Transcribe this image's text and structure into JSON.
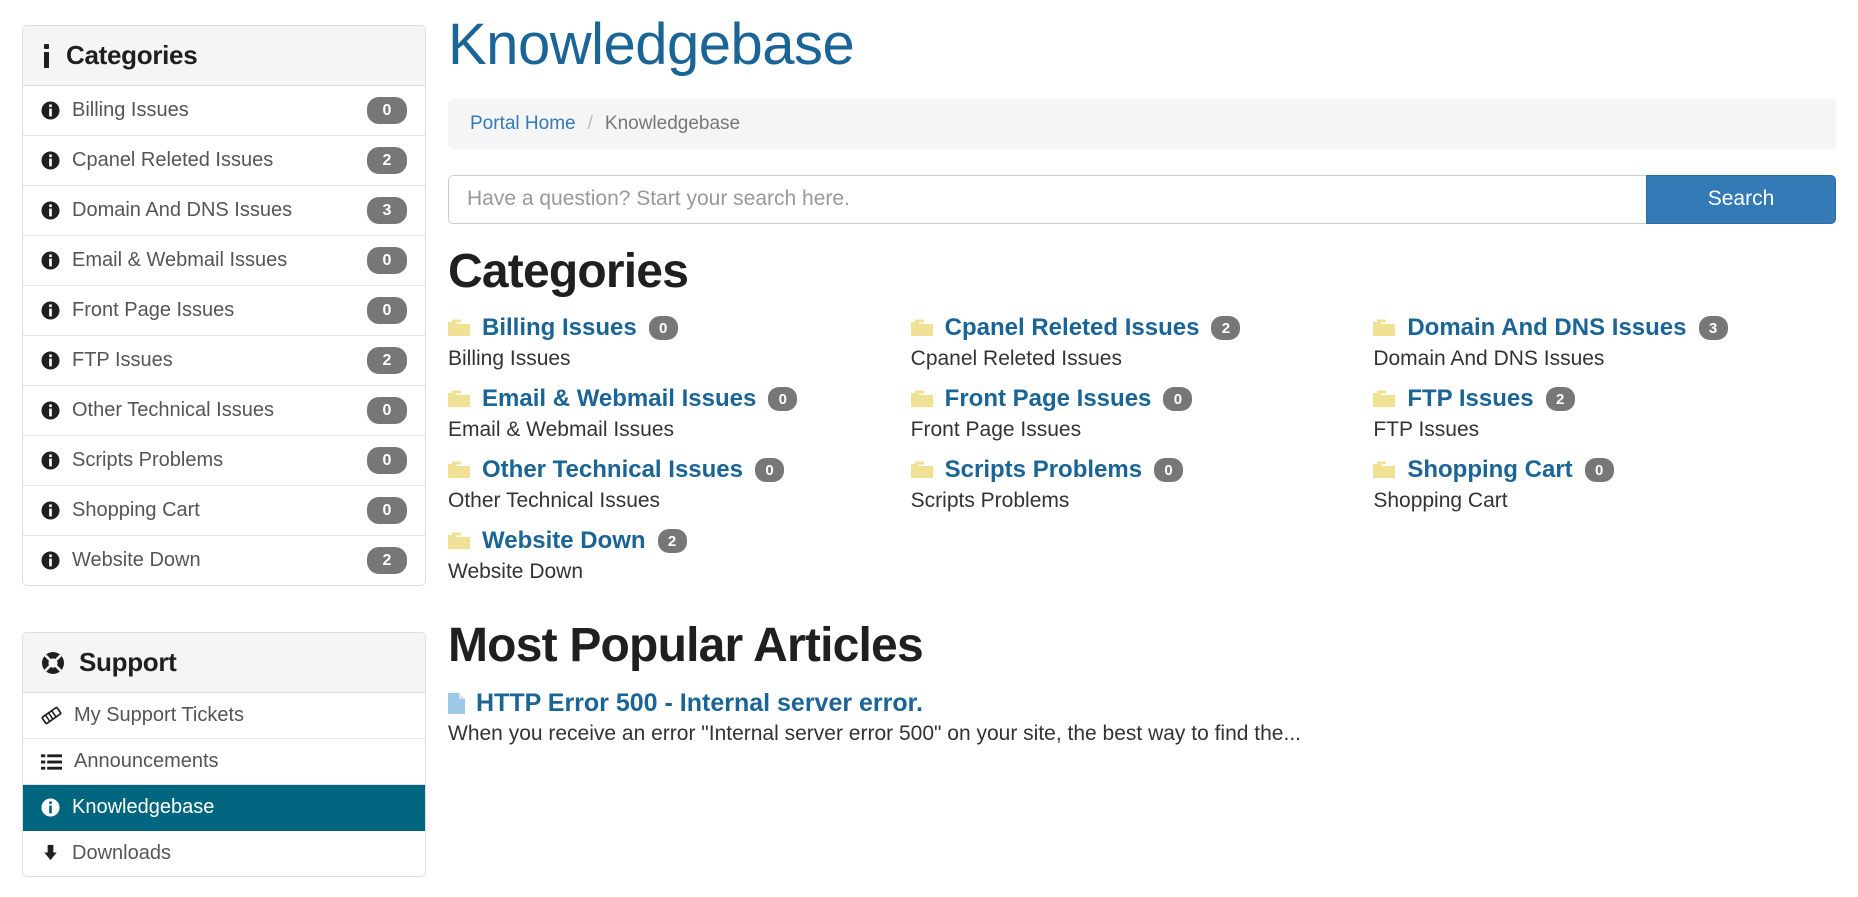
{
  "sidebar": {
    "categories_panel": {
      "icon": "info-icon",
      "title": "Categories",
      "items": [
        {
          "icon": "info-circle-icon",
          "label": "Billing Issues",
          "count": "0"
        },
        {
          "icon": "info-circle-icon",
          "label": "Cpanel Releted Issues",
          "count": "2"
        },
        {
          "icon": "info-circle-icon",
          "label": "Domain And DNS Issues",
          "count": "3"
        },
        {
          "icon": "info-circle-icon",
          "label": "Email & Webmail Issues",
          "count": "0"
        },
        {
          "icon": "info-circle-icon",
          "label": "Front Page Issues",
          "count": "0"
        },
        {
          "icon": "info-circle-icon",
          "label": "FTP Issues",
          "count": "2"
        },
        {
          "icon": "info-circle-icon",
          "label": "Other Technical Issues",
          "count": "0"
        },
        {
          "icon": "info-circle-icon",
          "label": "Scripts Problems",
          "count": "0"
        },
        {
          "icon": "info-circle-icon",
          "label": "Shopping Cart",
          "count": "0"
        },
        {
          "icon": "info-circle-icon",
          "label": "Website Down",
          "count": "2"
        }
      ]
    },
    "support_panel": {
      "icon": "lifebuoy-icon",
      "title": "Support",
      "items": [
        {
          "icon": "ticket-icon",
          "label": "My Support Tickets",
          "active": false
        },
        {
          "icon": "list-icon",
          "label": "Announcements",
          "active": false
        },
        {
          "icon": "info-circle-icon",
          "label": "Knowledgebase",
          "active": true
        },
        {
          "icon": "download-icon",
          "label": "Downloads",
          "active": false
        }
      ]
    }
  },
  "main": {
    "page_title": "Knowledgebase",
    "breadcrumb": {
      "home_label": "Portal Home",
      "separator": "/",
      "current_label": "Knowledgebase"
    },
    "search": {
      "placeholder": "Have a question? Start your search here.",
      "value": "",
      "button_label": "Search"
    },
    "categories_section": {
      "title": "Categories",
      "items": [
        {
          "icon": "folder-icon",
          "name": "Billing Issues",
          "count": "0",
          "description": "Billing Issues"
        },
        {
          "icon": "folder-icon",
          "name": "Cpanel Releted Issues",
          "count": "2",
          "description": "Cpanel Releted Issues"
        },
        {
          "icon": "folder-icon",
          "name": "Domain And DNS Issues",
          "count": "3",
          "description": "Domain And DNS Issues"
        },
        {
          "icon": "folder-icon",
          "name": "Email & Webmail Issues",
          "count": "0",
          "description": "Email & Webmail Issues"
        },
        {
          "icon": "folder-icon",
          "name": "Front Page Issues",
          "count": "0",
          "description": "Front Page Issues"
        },
        {
          "icon": "folder-icon",
          "name": "FTP Issues",
          "count": "2",
          "description": "FTP Issues"
        },
        {
          "icon": "folder-icon",
          "name": "Other Technical Issues",
          "count": "0",
          "description": "Other Technical Issues"
        },
        {
          "icon": "folder-icon",
          "name": "Scripts Problems",
          "count": "0",
          "description": "Scripts Problems"
        },
        {
          "icon": "folder-icon",
          "name": "Shopping Cart",
          "count": "0",
          "description": "Shopping Cart"
        },
        {
          "icon": "folder-icon",
          "name": "Website Down",
          "count": "2",
          "description": "Website Down"
        }
      ]
    },
    "popular_section": {
      "title": "Most Popular Articles",
      "articles": [
        {
          "icon": "file-icon",
          "title": "HTTP Error 500 - Internal server error.",
          "excerpt": "When you receive an error \"Internal server error 500\" on your site, the best way to find the..."
        }
      ]
    }
  },
  "colors": {
    "link_blue": "#1a6496",
    "breadcrumb_link": "#337ab7",
    "button_blue": "#337ab7",
    "active_item": "#00657f",
    "badge_gray": "#777777",
    "folder_yellow": "#f0e194",
    "file_blue": "#9cc9e8"
  }
}
